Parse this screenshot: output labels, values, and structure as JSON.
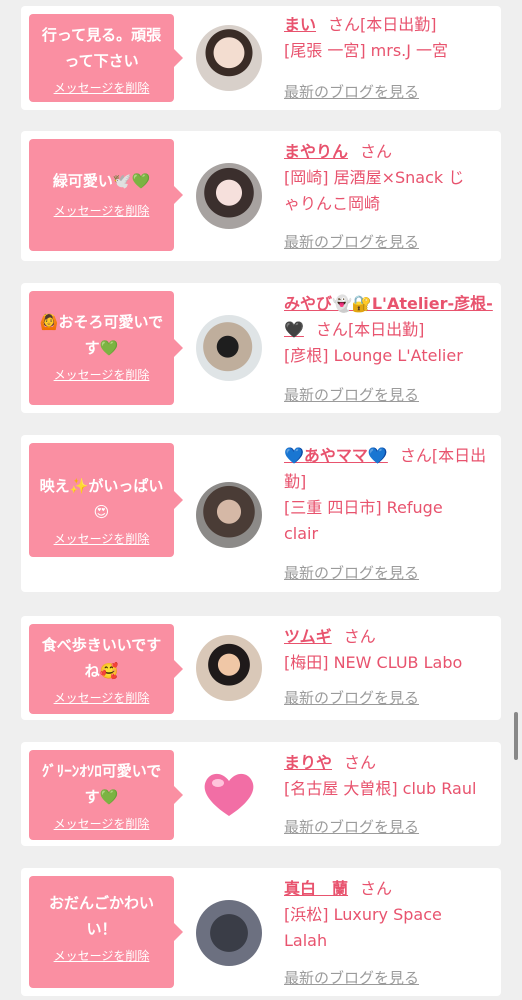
{
  "delete_label": "メッセージを削除",
  "blog_link_label": "最新のブログを見る",
  "honorific": "さん",
  "colors": {
    "accent": "#e8536e",
    "bubble": "#fa8fa2",
    "link_gray": "#9b9b9b",
    "background": "#efefef"
  },
  "cards": [
    {
      "message": [
        "行って見る。頑張",
        "って下さい"
      ],
      "name": "まい",
      "badge": "[本日出勤]",
      "shop": [
        "[尾張 一宮] mrs.J 一宮"
      ],
      "avatar_icon": "photo-avatar"
    },
    {
      "message": [
        "緑可愛い🕊️💚"
      ],
      "name": "まやりん",
      "badge": "",
      "shop": [
        "[岡崎] 居酒屋×Snack じ",
        "ゃりんこ岡崎"
      ],
      "avatar_icon": "photo-avatar"
    },
    {
      "message": [
        "🙆おそろ可愛いで",
        "す💚"
      ],
      "name": "みやび👻🔐L'Atelier-彦根-🖤",
      "badge": "[本日出勤]",
      "shop": [
        "[彦根] Lounge L'Atelier"
      ],
      "avatar_icon": "photo-avatar"
    },
    {
      "message": [
        "映え✨がいっぱい",
        "😍"
      ],
      "name": "💙あやママ💙",
      "badge": "[本日出勤]",
      "shop": [
        "[三重 四日市] Refuge",
        "clair"
      ],
      "avatar_icon": "photo-avatar"
    },
    {
      "message": [
        "食べ歩きいいです",
        "ね🥰"
      ],
      "name": "ツムギ",
      "badge": "",
      "shop": [
        "[梅田] NEW CLUB Labo"
      ],
      "avatar_icon": "photo-avatar"
    },
    {
      "message": [
        "ｸﾞﾘｰﾝｵｿﾛ可愛いで",
        "す💚"
      ],
      "name": "まりや",
      "badge": "",
      "shop": [
        "[名古屋 大曽根] club Raul"
      ],
      "avatar_icon": "heart-avatar"
    },
    {
      "message": [
        "おだんごかわい",
        "い！"
      ],
      "name": "真白　蘭",
      "badge": "",
      "shop": [
        "[浜松] Luxury Space",
        "Lalah"
      ],
      "avatar_icon": "photo-avatar"
    }
  ]
}
